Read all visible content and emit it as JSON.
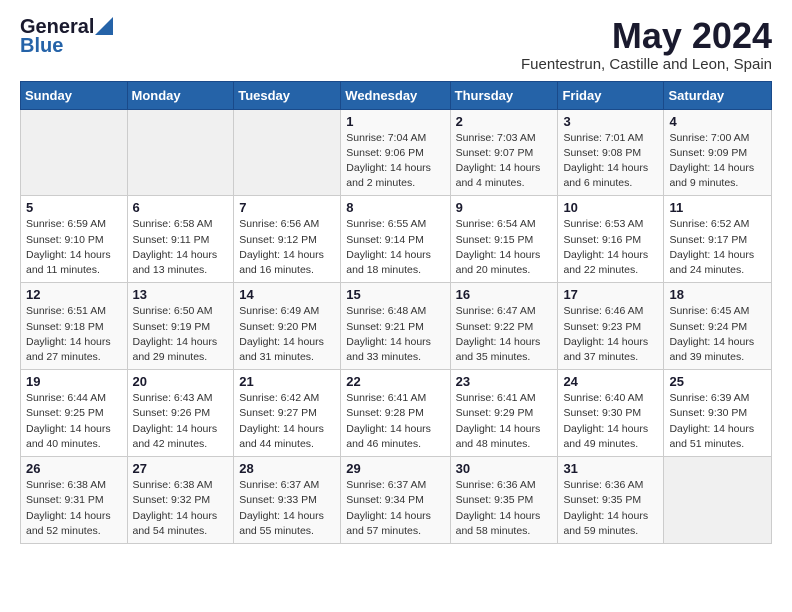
{
  "header": {
    "logo_general": "General",
    "logo_blue": "Blue",
    "title": "May 2024",
    "subtitle": "Fuentestrun, Castille and Leon, Spain"
  },
  "days_of_week": [
    "Sunday",
    "Monday",
    "Tuesday",
    "Wednesday",
    "Thursday",
    "Friday",
    "Saturday"
  ],
  "weeks": [
    [
      {
        "day": "",
        "info": ""
      },
      {
        "day": "",
        "info": ""
      },
      {
        "day": "",
        "info": ""
      },
      {
        "day": "1",
        "info": "Sunrise: 7:04 AM\nSunset: 9:06 PM\nDaylight: 14 hours\nand 2 minutes."
      },
      {
        "day": "2",
        "info": "Sunrise: 7:03 AM\nSunset: 9:07 PM\nDaylight: 14 hours\nand 4 minutes."
      },
      {
        "day": "3",
        "info": "Sunrise: 7:01 AM\nSunset: 9:08 PM\nDaylight: 14 hours\nand 6 minutes."
      },
      {
        "day": "4",
        "info": "Sunrise: 7:00 AM\nSunset: 9:09 PM\nDaylight: 14 hours\nand 9 minutes."
      }
    ],
    [
      {
        "day": "5",
        "info": "Sunrise: 6:59 AM\nSunset: 9:10 PM\nDaylight: 14 hours\nand 11 minutes."
      },
      {
        "day": "6",
        "info": "Sunrise: 6:58 AM\nSunset: 9:11 PM\nDaylight: 14 hours\nand 13 minutes."
      },
      {
        "day": "7",
        "info": "Sunrise: 6:56 AM\nSunset: 9:12 PM\nDaylight: 14 hours\nand 16 minutes."
      },
      {
        "day": "8",
        "info": "Sunrise: 6:55 AM\nSunset: 9:14 PM\nDaylight: 14 hours\nand 18 minutes."
      },
      {
        "day": "9",
        "info": "Sunrise: 6:54 AM\nSunset: 9:15 PM\nDaylight: 14 hours\nand 20 minutes."
      },
      {
        "day": "10",
        "info": "Sunrise: 6:53 AM\nSunset: 9:16 PM\nDaylight: 14 hours\nand 22 minutes."
      },
      {
        "day": "11",
        "info": "Sunrise: 6:52 AM\nSunset: 9:17 PM\nDaylight: 14 hours\nand 24 minutes."
      }
    ],
    [
      {
        "day": "12",
        "info": "Sunrise: 6:51 AM\nSunset: 9:18 PM\nDaylight: 14 hours\nand 27 minutes."
      },
      {
        "day": "13",
        "info": "Sunrise: 6:50 AM\nSunset: 9:19 PM\nDaylight: 14 hours\nand 29 minutes."
      },
      {
        "day": "14",
        "info": "Sunrise: 6:49 AM\nSunset: 9:20 PM\nDaylight: 14 hours\nand 31 minutes."
      },
      {
        "day": "15",
        "info": "Sunrise: 6:48 AM\nSunset: 9:21 PM\nDaylight: 14 hours\nand 33 minutes."
      },
      {
        "day": "16",
        "info": "Sunrise: 6:47 AM\nSunset: 9:22 PM\nDaylight: 14 hours\nand 35 minutes."
      },
      {
        "day": "17",
        "info": "Sunrise: 6:46 AM\nSunset: 9:23 PM\nDaylight: 14 hours\nand 37 minutes."
      },
      {
        "day": "18",
        "info": "Sunrise: 6:45 AM\nSunset: 9:24 PM\nDaylight: 14 hours\nand 39 minutes."
      }
    ],
    [
      {
        "day": "19",
        "info": "Sunrise: 6:44 AM\nSunset: 9:25 PM\nDaylight: 14 hours\nand 40 minutes."
      },
      {
        "day": "20",
        "info": "Sunrise: 6:43 AM\nSunset: 9:26 PM\nDaylight: 14 hours\nand 42 minutes."
      },
      {
        "day": "21",
        "info": "Sunrise: 6:42 AM\nSunset: 9:27 PM\nDaylight: 14 hours\nand 44 minutes."
      },
      {
        "day": "22",
        "info": "Sunrise: 6:41 AM\nSunset: 9:28 PM\nDaylight: 14 hours\nand 46 minutes."
      },
      {
        "day": "23",
        "info": "Sunrise: 6:41 AM\nSunset: 9:29 PM\nDaylight: 14 hours\nand 48 minutes."
      },
      {
        "day": "24",
        "info": "Sunrise: 6:40 AM\nSunset: 9:30 PM\nDaylight: 14 hours\nand 49 minutes."
      },
      {
        "day": "25",
        "info": "Sunrise: 6:39 AM\nSunset: 9:30 PM\nDaylight: 14 hours\nand 51 minutes."
      }
    ],
    [
      {
        "day": "26",
        "info": "Sunrise: 6:38 AM\nSunset: 9:31 PM\nDaylight: 14 hours\nand 52 minutes."
      },
      {
        "day": "27",
        "info": "Sunrise: 6:38 AM\nSunset: 9:32 PM\nDaylight: 14 hours\nand 54 minutes."
      },
      {
        "day": "28",
        "info": "Sunrise: 6:37 AM\nSunset: 9:33 PM\nDaylight: 14 hours\nand 55 minutes."
      },
      {
        "day": "29",
        "info": "Sunrise: 6:37 AM\nSunset: 9:34 PM\nDaylight: 14 hours\nand 57 minutes."
      },
      {
        "day": "30",
        "info": "Sunrise: 6:36 AM\nSunset: 9:35 PM\nDaylight: 14 hours\nand 58 minutes."
      },
      {
        "day": "31",
        "info": "Sunrise: 6:36 AM\nSunset: 9:35 PM\nDaylight: 14 hours\nand 59 minutes."
      },
      {
        "day": "",
        "info": ""
      }
    ]
  ]
}
